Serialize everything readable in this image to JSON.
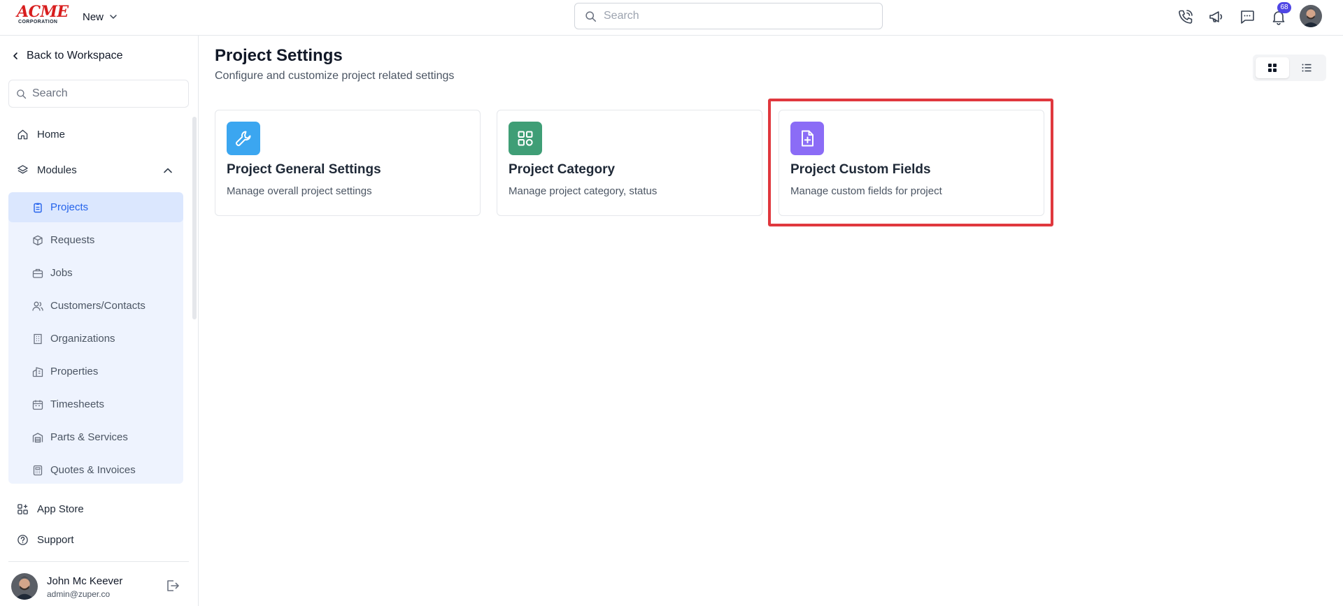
{
  "brand": {
    "logo_main": "ACME",
    "logo_sub": "CORPORATION"
  },
  "topbar": {
    "new_label": "New",
    "search_placeholder": "Search",
    "notification_count": "68",
    "icons": [
      "phone-icon",
      "megaphone-icon",
      "chat-icon",
      "bell-icon",
      "user-avatar"
    ]
  },
  "sidebar": {
    "back_label": "Back to Workspace",
    "search_placeholder": "Search",
    "home_label": "Home",
    "modules_label": "Modules",
    "modules": [
      {
        "label": "Projects",
        "icon": "clipboard-icon",
        "active": true
      },
      {
        "label": "Requests",
        "icon": "box-icon"
      },
      {
        "label": "Jobs",
        "icon": "briefcase-icon"
      },
      {
        "label": "Customers/Contacts",
        "icon": "users-icon"
      },
      {
        "label": "Organizations",
        "icon": "building-icon"
      },
      {
        "label": "Properties",
        "icon": "properties-icon"
      },
      {
        "label": "Timesheets",
        "icon": "calendar-icon"
      },
      {
        "label": "Parts & Services",
        "icon": "warehouse-icon"
      },
      {
        "label": "Quotes & Invoices",
        "icon": "calculator-icon"
      }
    ],
    "app_store_label": "App Store",
    "support_label": "Support",
    "user": {
      "name": "John Mc Keever",
      "email": "admin@zuper.co"
    }
  },
  "main": {
    "title": "Project Settings",
    "subtitle": "Configure and customize project related settings",
    "view_mode": "grid",
    "cards": [
      {
        "title": "Project General Settings",
        "description": "Manage overall project settings",
        "icon": "wrench-icon",
        "color": "#3ba6f0"
      },
      {
        "title": "Project Category",
        "description": "Manage project category, status",
        "icon": "grid-icon",
        "color": "#3f9e76"
      },
      {
        "title": "Project Custom Fields",
        "description": "Manage custom fields for project",
        "icon": "file-plus-icon",
        "color": "#8b6cf6",
        "highlighted": true
      }
    ]
  },
  "colors": {
    "accent": "#2563eb",
    "highlight": "#e0383e",
    "active_bg": "#dbe7fe",
    "submenu_bg": "#eef3fe"
  }
}
